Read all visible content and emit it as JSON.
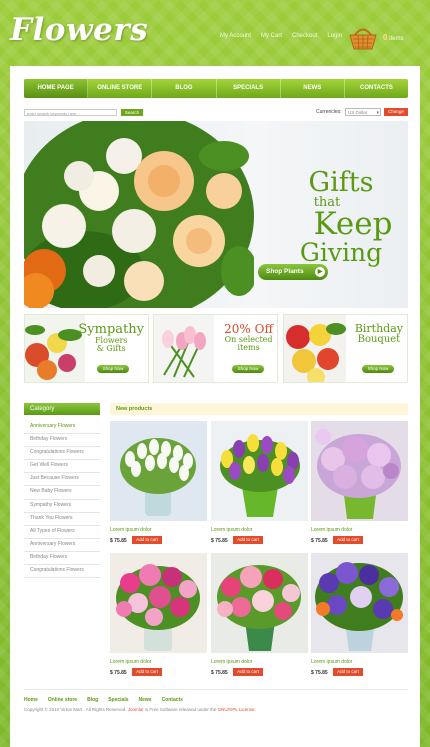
{
  "header": {
    "logo": "Flowers",
    "links": [
      "My Account",
      "My Cart",
      "Checkout",
      "Login"
    ],
    "cart_count": "0",
    "cart_label": "items"
  },
  "nav": [
    "HOME PAGE",
    "ONLINE STORE",
    "BLOG",
    "SPECIALS",
    "NEWS",
    "CONTACTS"
  ],
  "search": {
    "placeholder": "enter search keywords here",
    "button": "Search"
  },
  "currency": {
    "label": "Currencies:",
    "selected": "US Dollar",
    "button": "Change"
  },
  "hero": {
    "line1": "Gifts",
    "line2": "that",
    "line3": "Keep",
    "line4": "Giving",
    "button": "Shop Plants"
  },
  "promos": [
    {
      "line1": "Sympathy",
      "line2": "Flowers",
      "line3": "& Gifts",
      "button": "Shop Now"
    },
    {
      "line1": "20% Off",
      "line2": "On selected",
      "line3": "items",
      "button": "Shop Now"
    },
    {
      "line1": "Birthday",
      "line2": "Bouquet",
      "line3": "",
      "button": "Shop Now"
    }
  ],
  "category": {
    "title": "Category",
    "items": [
      "Anniversary Flowers",
      "Birthday Flowers",
      "Congratulations Flowers",
      "Get Well Flowers",
      "Just Because Flowers",
      "New Baby Flowers",
      "Sympathy Flowers",
      "Thank You Flowers",
      "All Types of Flowers",
      "Anniversary Flowers",
      "Birthday Flowers",
      "Congratulations Flowers"
    ]
  },
  "products": {
    "title": "New products",
    "items": [
      {
        "name": "Lorem ipsum dolor",
        "price": "$ 75.85",
        "button": "Add to cart"
      },
      {
        "name": "Lorem ipsum dolor",
        "price": "$ 75.85",
        "button": "Add to cart"
      },
      {
        "name": "Lorem ipsum dolor",
        "price": "$ 75.85",
        "button": "Add to cart"
      },
      {
        "name": "Lorem ipsum dolor",
        "price": "$ 75.85",
        "button": "Add to cart"
      },
      {
        "name": "Lorem ipsum dolor",
        "price": "$ 75.85",
        "button": "Add to cart"
      },
      {
        "name": "Lorem ipsum dolor",
        "price": "$ 75.85",
        "button": "Add to cart"
      }
    ]
  },
  "footer": {
    "links": [
      "Home",
      "Online store",
      "Blog",
      "Specials",
      "News",
      "Contacts"
    ],
    "copyright": "Copyright © 2010 Virtue Mart . All Rights Reserved.",
    "joomla": "Joomla!",
    "copyright_tail": "is Free Software released under the",
    "license": "GNU/GPL License."
  },
  "colors": {
    "brand_green": "#8cc63f",
    "dark_green": "#5a9a12",
    "accent_red": "#e24b2b",
    "header_orange": "#ffe07a"
  }
}
